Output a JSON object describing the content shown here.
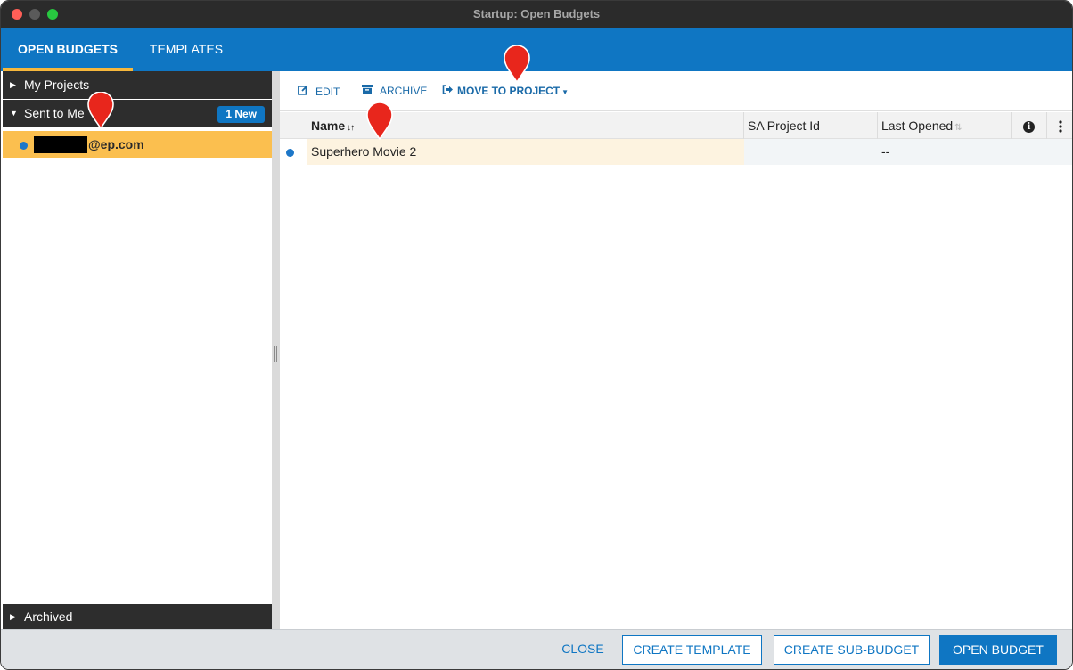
{
  "window": {
    "title": "Startup: Open Budgets"
  },
  "tabs": [
    {
      "label": "OPEN BUDGETS",
      "active": true
    },
    {
      "label": "TEMPLATES",
      "active": false
    }
  ],
  "sidebar": {
    "my_projects": "My Projects",
    "sent_to_me": "Sent to Me",
    "new_badge": "1 New",
    "item_email_suffix": "@ep.com",
    "archived": "Archived"
  },
  "toolbar": {
    "edit": "EDIT",
    "archive": "ARCHIVE",
    "move_to_project": "MOVE TO PROJECT"
  },
  "grid": {
    "columns": {
      "name": "Name",
      "sa_project_id": "SA Project Id",
      "last_opened": "Last Opened"
    },
    "rows": [
      {
        "name": "Superhero Movie 2",
        "sa_project_id": "",
        "last_opened": "--",
        "unread": true
      }
    ]
  },
  "footer": {
    "close": "CLOSE",
    "create_template": "CREATE TEMPLATE",
    "create_sub_budget": "CREATE SUB-BUDGET",
    "open_budget": "OPEN BUDGET"
  },
  "colors": {
    "accent": "#0f76c3",
    "tab_indicator": "#f6b73c",
    "selected_item": "#fbbf4f",
    "marker": "#e8261c"
  },
  "icons": [
    "edit-icon",
    "archive-icon",
    "move-to-project-icon",
    "sort-icon",
    "info-icon",
    "more-vertical-icon",
    "caret-right-icon",
    "caret-down-icon"
  ]
}
